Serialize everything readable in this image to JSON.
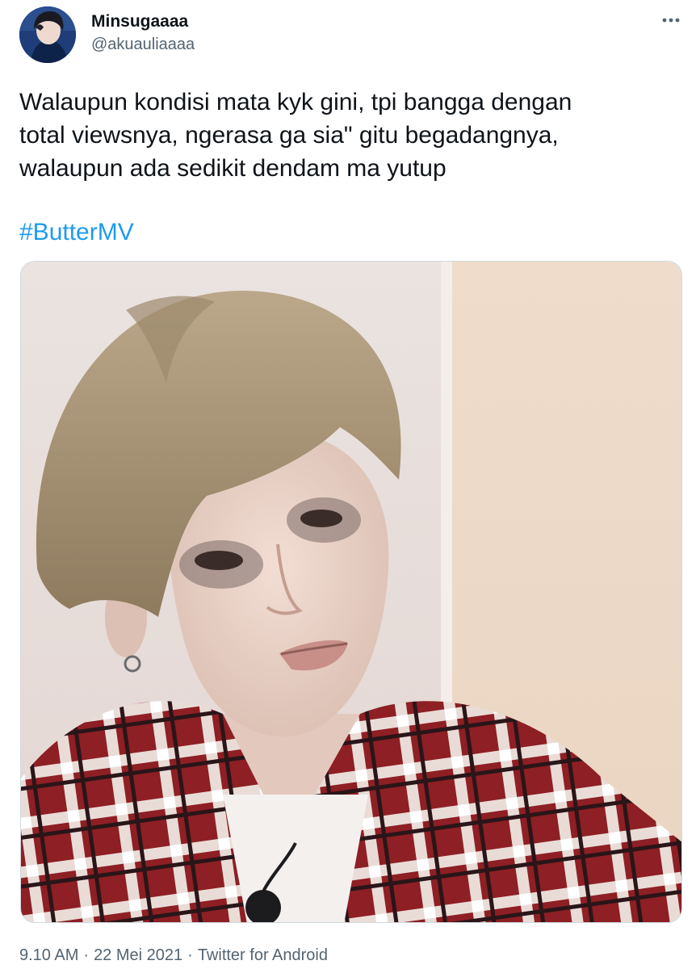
{
  "tweet": {
    "author": {
      "display_name": "Minsugaaaa",
      "handle": "@akuauliaaaa"
    },
    "text_lines": [
      "Walaupun kondisi mata kyk gini, tpi bangga dengan",
      "total viewsnya, ngerasa ga sia\" gitu begadangnya,",
      "walaupun ada sedikit dendam ma yutup"
    ],
    "hashtag": "#ButterMV",
    "meta": {
      "time": "9.10 AM",
      "separator": "·",
      "date": "22 Mei 2021",
      "source": "Twitter for Android"
    },
    "icons": {
      "more": "more-horizontal-icon"
    },
    "colors": {
      "text": "#0f1419",
      "secondary": "#536471",
      "link": "#1d9bf0"
    }
  }
}
